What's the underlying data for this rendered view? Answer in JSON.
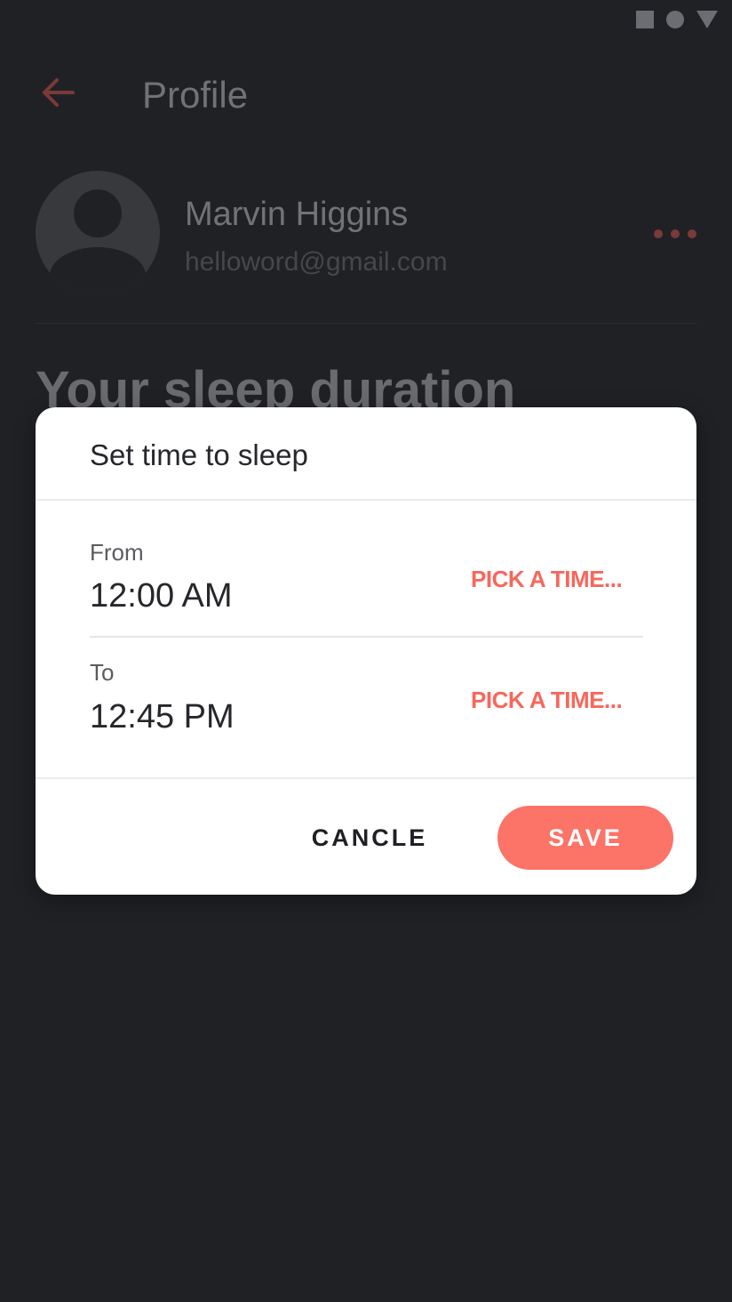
{
  "status_bar": {
    "icons": [
      "stop-square-icon",
      "circle-icon",
      "triangle-down-icon"
    ]
  },
  "app_bar": {
    "back_icon": "arrow-left-icon",
    "title": "Profile"
  },
  "profile": {
    "avatar_icon": "user-avatar-icon",
    "name": "Marvin Higgins",
    "email": "helloword@gmail.com",
    "more_icon": "more-horizontal-icon"
  },
  "sleep_section": {
    "heading": "Your sleep duration"
  },
  "dialog": {
    "title": "Set time to sleep",
    "from": {
      "label": "From",
      "time": "12:00 AM",
      "pick_label": "PICK A TIME..."
    },
    "to": {
      "label": "To",
      "time": "12:45 PM",
      "pick_label": "PICK A TIME..."
    },
    "cancel_label": "CANCLE",
    "save_label": "SAVE"
  },
  "colors": {
    "background": "#202125",
    "accent": "#fc7367",
    "dialog_background": "#ffffff"
  }
}
